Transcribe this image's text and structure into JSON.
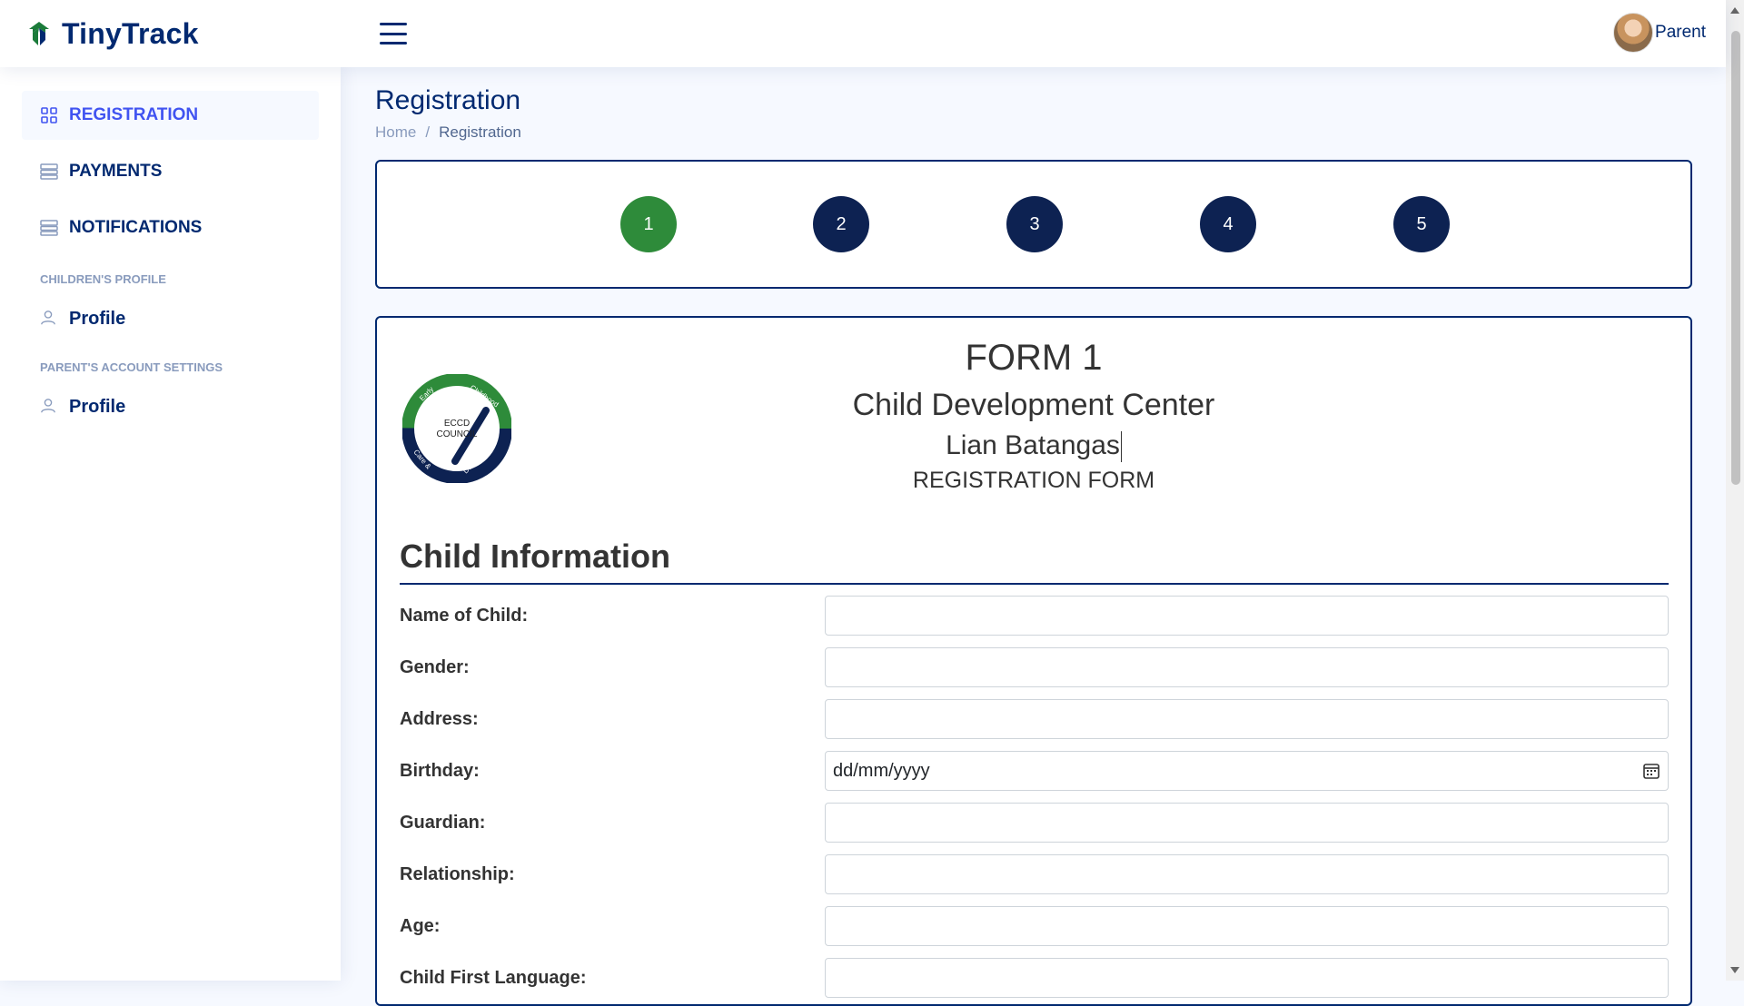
{
  "header": {
    "app_name": "TinyTrack",
    "profile_name": "Parent"
  },
  "sidebar": {
    "items": [
      {
        "label": "REGISTRATION",
        "icon": "grid-icon",
        "active": true
      },
      {
        "label": "PAYMENTS",
        "icon": "menu-button-icon"
      },
      {
        "label": "NOTIFICATIONS",
        "icon": "menu-button-icon"
      }
    ],
    "children_heading": "CHILDREN'S PROFILE",
    "children_profile": "Profile",
    "parent_heading": "PARENT'S ACCOUNT SETTINGS",
    "parent_profile": "Profile"
  },
  "page": {
    "title": "Registration",
    "breadcrumb": {
      "home": "Home",
      "sep": "/",
      "current": "Registration"
    }
  },
  "steps": [
    "1",
    "2",
    "3",
    "4",
    "5"
  ],
  "active_step": "1",
  "form": {
    "seal_text_1": "ECCD",
    "seal_text_2": "COUNCIL",
    "seal_arc_1": "Early",
    "seal_arc_2": "Childhood",
    "seal_arc_3": "Care &",
    "seal_arc_4": "Development",
    "number": "FORM 1",
    "center": "Child Development Center",
    "location": "Lian Batangas",
    "subtitle": "REGISTRATION FORM",
    "section": "Child Information",
    "fields": {
      "name": {
        "label": "Name of Child:",
        "value": ""
      },
      "gender": {
        "label": "Gender:",
        "value": ""
      },
      "address": {
        "label": "Address:",
        "value": ""
      },
      "birthday": {
        "label": "Birthday:",
        "placeholder": "dd/mm/yyyy"
      },
      "guardian": {
        "label": "Guardian:",
        "value": ""
      },
      "relationship": {
        "label": "Relationship:",
        "value": ""
      },
      "age": {
        "label": "Age:",
        "value": ""
      },
      "language": {
        "label": "Child First Language:",
        "value": ""
      }
    }
  },
  "colors": {
    "primary": "#012970",
    "active_step": "#2e8b3a",
    "step": "#0d2252",
    "link_active": "#4154f1"
  }
}
